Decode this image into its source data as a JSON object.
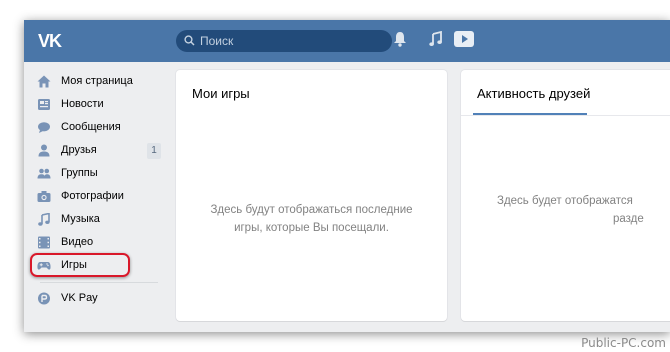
{
  "header": {
    "logo": "VK",
    "search": {
      "placeholder": "Поиск"
    },
    "icons": [
      "bell-icon",
      "music-note-icon",
      "play-icon"
    ]
  },
  "sidebar": {
    "items": [
      {
        "label": "Моя страница",
        "icon": "home-icon"
      },
      {
        "label": "Новости",
        "icon": "news-icon"
      },
      {
        "label": "Сообщения",
        "icon": "messages-icon"
      },
      {
        "label": "Друзья",
        "icon": "friends-icon",
        "badge": "1"
      },
      {
        "label": "Группы",
        "icon": "groups-icon"
      },
      {
        "label": "Фотографии",
        "icon": "camera-icon"
      },
      {
        "label": "Музыка",
        "icon": "music-icon"
      },
      {
        "label": "Видео",
        "icon": "video-icon"
      },
      {
        "label": "Игры",
        "icon": "gamepad-icon",
        "highlighted": true
      }
    ],
    "extra": {
      "label": "VK Pay",
      "icon": "vkpay-icon"
    }
  },
  "my_games": {
    "title": "Мои игры",
    "empty_line1": "Здесь будут отображаться последние",
    "empty_line2": "игры, которые Вы посещали."
  },
  "friends_activity": {
    "tab": "Активность друзей",
    "empty_line1": "Здесь будет отображатся",
    "empty_line2": "разде"
  },
  "watermark": "Public-PC.com",
  "colors": {
    "header": "#4a76a8",
    "highlight": "#d9182a",
    "accent": "#5181b8"
  }
}
